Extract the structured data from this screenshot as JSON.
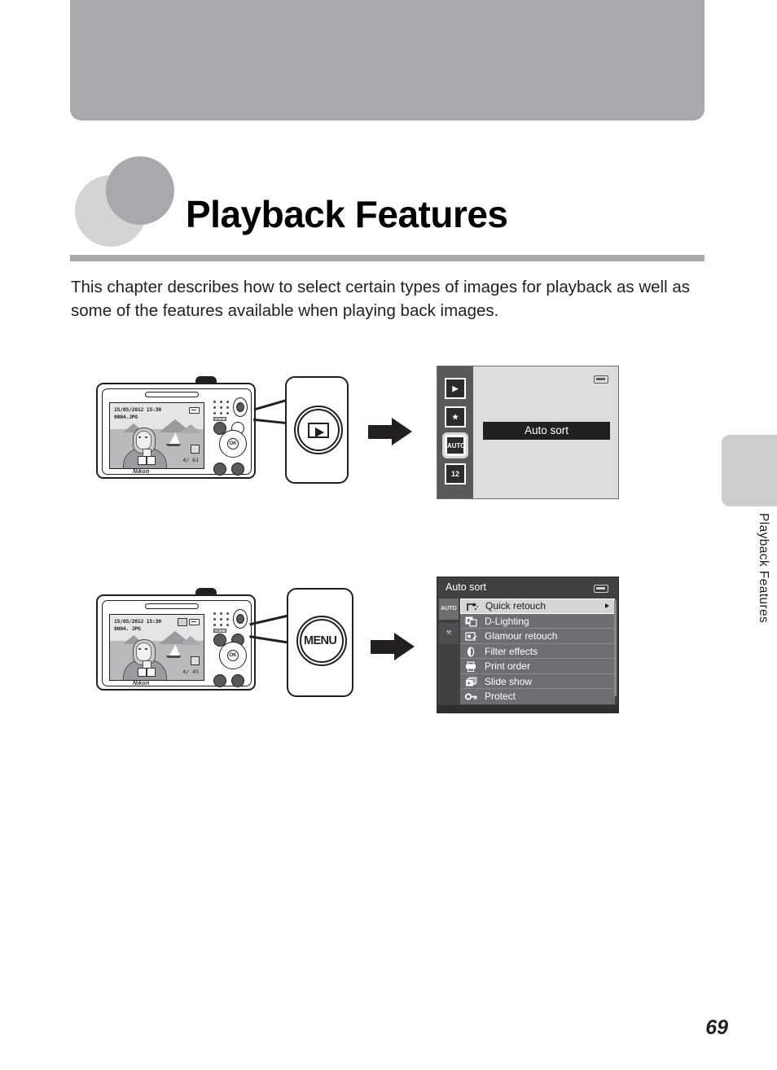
{
  "page": {
    "number": "69",
    "side_tab_label": "Playback Features"
  },
  "chapter": {
    "title": "Playback Features",
    "intro": "This chapter describes how to select certain types of images for playback as well as some of the features available when playing back images."
  },
  "figures": [
    {
      "id": "figure-playback-button",
      "camera": {
        "lcd": {
          "datetime": "15/05/2012 15:30",
          "filename": "0004.JPG",
          "counter": "4/ 61",
          "brand": "Nikon"
        },
        "mode_label": "SCENE"
      },
      "callout": {
        "button_name": "playback-button",
        "glyph": "play-triangle"
      },
      "arrow": "right-block-arrow",
      "screen": {
        "type": "playback-mode-selector",
        "sidebar_icons": [
          {
            "name": "playback-mode-icon",
            "label": "▶"
          },
          {
            "name": "favorite-pictures-icon",
            "label": "★"
          },
          {
            "name": "auto-sort-icon",
            "label": "AUTO",
            "selected": true
          },
          {
            "name": "list-by-date-icon",
            "label": "12"
          }
        ],
        "highlight_label": "Auto sort",
        "battery_icon": "battery-icon"
      }
    },
    {
      "id": "figure-menu-button",
      "camera": {
        "lcd": {
          "datetime": "15/05/2012 15:30",
          "filename": "0004. JPG",
          "counter": "4/ 45",
          "brand": "Nikon"
        }
      },
      "callout": {
        "button_name": "menu-button",
        "label": "MENU"
      },
      "arrow": "right-block-arrow",
      "screen": {
        "type": "playback-menu",
        "title": "Auto sort",
        "battery_icon": "battery-icon",
        "tabs": [
          {
            "name": "auto-sort-tab",
            "label": "AUTO",
            "active": true
          },
          {
            "name": "setup-tab",
            "label": "⚒",
            "active": false
          }
        ],
        "items": [
          {
            "label": "Quick retouch",
            "icon": "quick-retouch-icon",
            "selected": true,
            "has_submenu": true
          },
          {
            "label": "D-Lighting",
            "icon": "d-lighting-icon",
            "selected": false,
            "has_submenu": false
          },
          {
            "label": "Glamour retouch",
            "icon": "glamour-retouch-icon",
            "selected": false,
            "has_submenu": false
          },
          {
            "label": "Filter effects",
            "icon": "filter-effects-icon",
            "selected": false,
            "has_submenu": false
          },
          {
            "label": "Print order",
            "icon": "print-order-icon",
            "selected": false,
            "has_submenu": false
          },
          {
            "label": "Slide show",
            "icon": "slide-show-icon",
            "selected": false,
            "has_submenu": false
          },
          {
            "label": "Protect",
            "icon": "protect-key-icon",
            "selected": false,
            "has_submenu": false
          }
        ]
      }
    }
  ],
  "colors": {
    "band_gray": "#a7a9ac",
    "light_gray": "#d3d4d6",
    "tab_gray": "#cccdcf",
    "ink": "#231f20",
    "menu_dark": "#404041",
    "menu_row": "#6d6e71",
    "menu_selected": "#d4d5d7"
  }
}
